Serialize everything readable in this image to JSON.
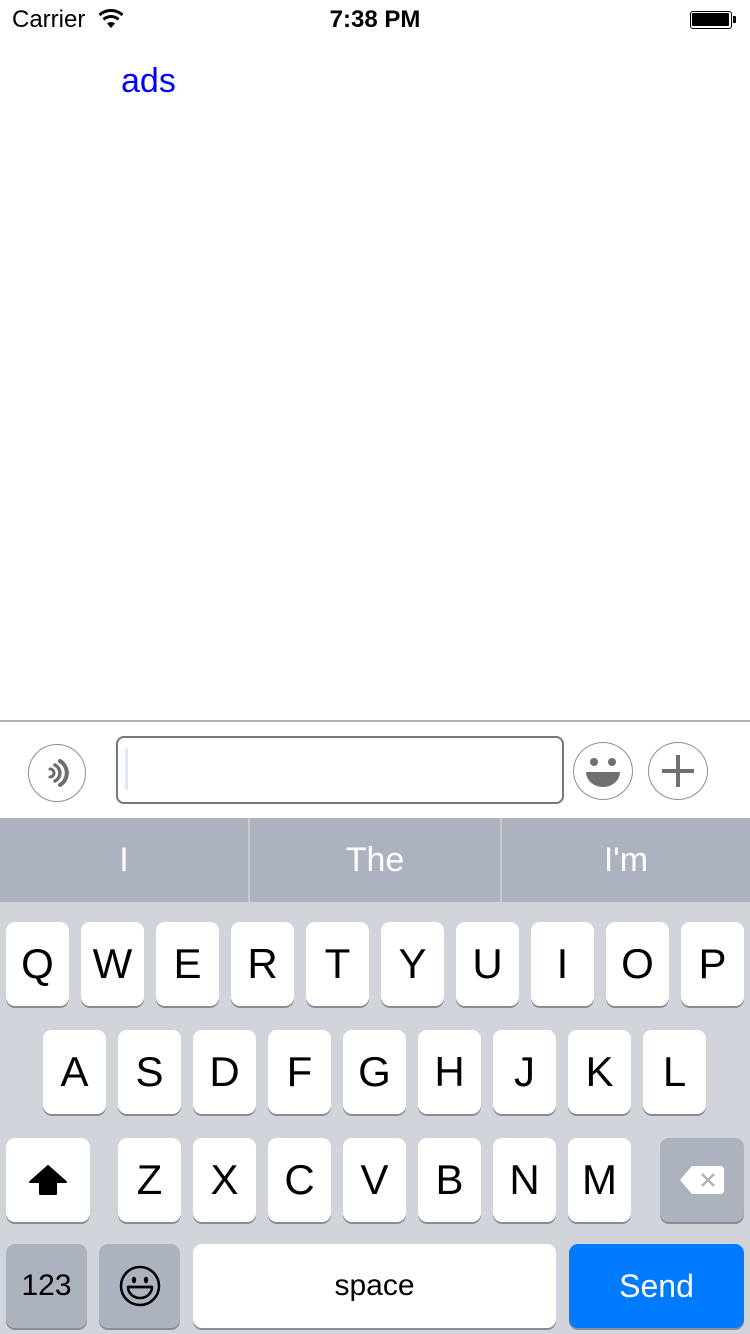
{
  "status_bar": {
    "carrier": "Carrier",
    "wifi_icon": "wifi-icon",
    "time": "7:38 PM",
    "battery_icon": "battery-full-icon"
  },
  "content": {
    "link_text": "ads",
    "link_color": "#0000ff"
  },
  "input_bar": {
    "voice_icon": "voice-icon",
    "message_value": "",
    "emoji_icon": "emoji-icon",
    "plus_icon": "plus-icon"
  },
  "keyboard": {
    "predictions": [
      "I",
      "The",
      "I'm"
    ],
    "row1": [
      "Q",
      "W",
      "E",
      "R",
      "T",
      "Y",
      "U",
      "I",
      "O",
      "P"
    ],
    "row2": [
      "A",
      "S",
      "D",
      "F",
      "G",
      "H",
      "J",
      "K",
      "L"
    ],
    "row3": [
      "Z",
      "X",
      "C",
      "V",
      "B",
      "N",
      "M"
    ],
    "shift_icon": "shift-icon",
    "delete_icon": "delete-icon",
    "numbers_label": "123",
    "emoji_key_icon": "emoji-keyboard-icon",
    "space_label": "space",
    "send_label": "Send",
    "send_color": "#007aff"
  }
}
